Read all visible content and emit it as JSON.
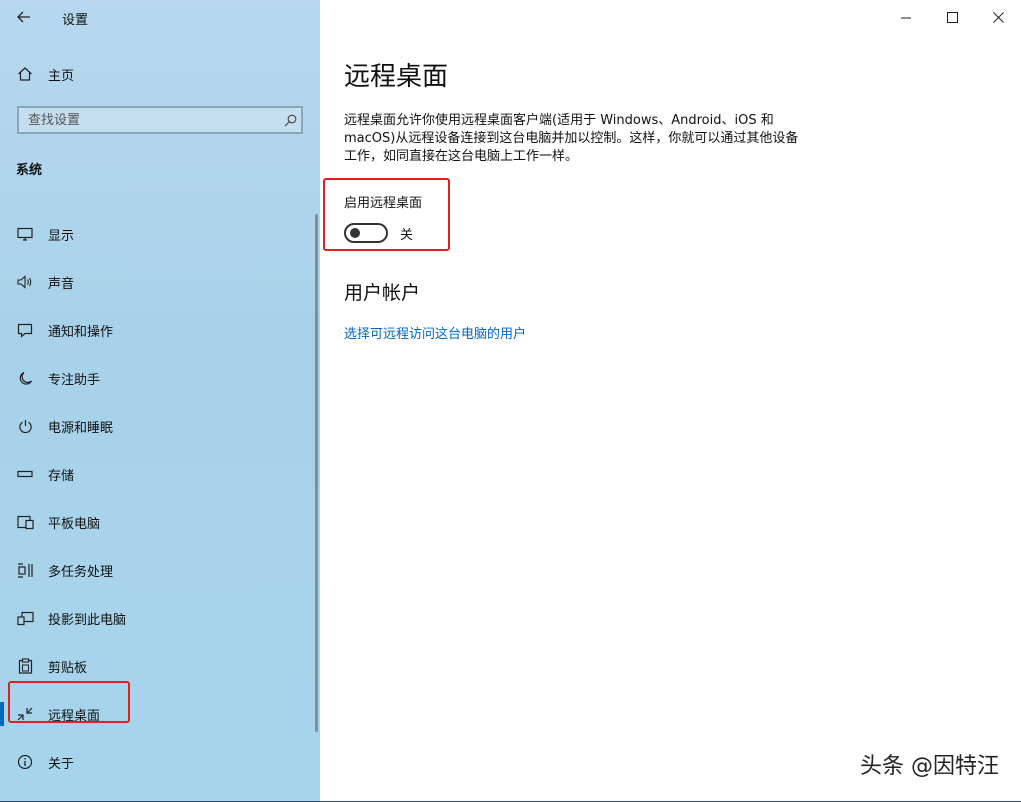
{
  "app": {
    "title": "设置"
  },
  "sidebar": {
    "home_label": "主页",
    "search_placeholder": "查找设置",
    "section": "系统",
    "items": [
      {
        "label": "显示",
        "icon": "monitor-icon"
      },
      {
        "label": "声音",
        "icon": "speaker-icon"
      },
      {
        "label": "通知和操作",
        "icon": "notification-icon"
      },
      {
        "label": "专注助手",
        "icon": "moon-icon"
      },
      {
        "label": "电源和睡眠",
        "icon": "power-icon"
      },
      {
        "label": "存储",
        "icon": "storage-icon"
      },
      {
        "label": "平板电脑",
        "icon": "tablet-icon"
      },
      {
        "label": "多任务处理",
        "icon": "multitask-icon"
      },
      {
        "label": "投影到此电脑",
        "icon": "project-icon"
      },
      {
        "label": "剪贴板",
        "icon": "clipboard-icon"
      },
      {
        "label": "远程桌面",
        "icon": "remote-desktop-icon",
        "active": true
      },
      {
        "label": "关于",
        "icon": "info-icon"
      }
    ]
  },
  "main": {
    "title": "远程桌面",
    "description": "远程桌面允许你使用远程桌面客户端(适用于 Windows、Android、iOS 和 macOS)从远程设备连接到这台电脑并加以控制。这样，你就可以通过其他设备工作，如同直接在这台电脑上工作一样。",
    "toggle_label": "启用远程桌面",
    "toggle_state": "关",
    "accounts_title": "用户帐户",
    "accounts_link": "选择可远程访问这台电脑的用户"
  },
  "watermark": "头条 @因特汪",
  "colors": {
    "accent": "#0067c0",
    "highlight": "#e02020",
    "sidebar_bg": "#a9d2ea"
  }
}
